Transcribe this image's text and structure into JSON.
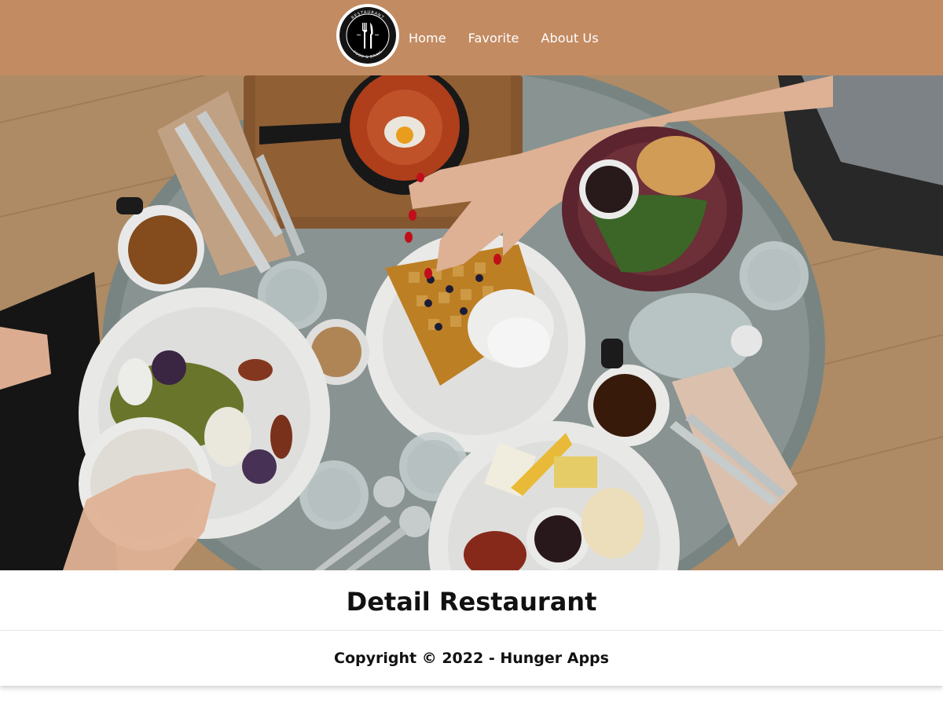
{
  "header": {
    "logo": {
      "icon": "fork-knife-icon",
      "ring_text_top": "RESTAURANT",
      "ring_text_bottom": "FOOD & DRINK"
    },
    "nav": [
      {
        "label": "Home"
      },
      {
        "label": "Favorite"
      },
      {
        "label": "About Us"
      }
    ],
    "bg_color": "#c38b62"
  },
  "hero": {
    "image": "restaurant-table-food-photo",
    "alt": "Overhead photo of a breakfast table with waffles, coffee, and plates"
  },
  "main": {
    "title": "Detail Restaurant"
  },
  "footer": {
    "copyright": "Copyright © 2022 - Hunger Apps"
  }
}
